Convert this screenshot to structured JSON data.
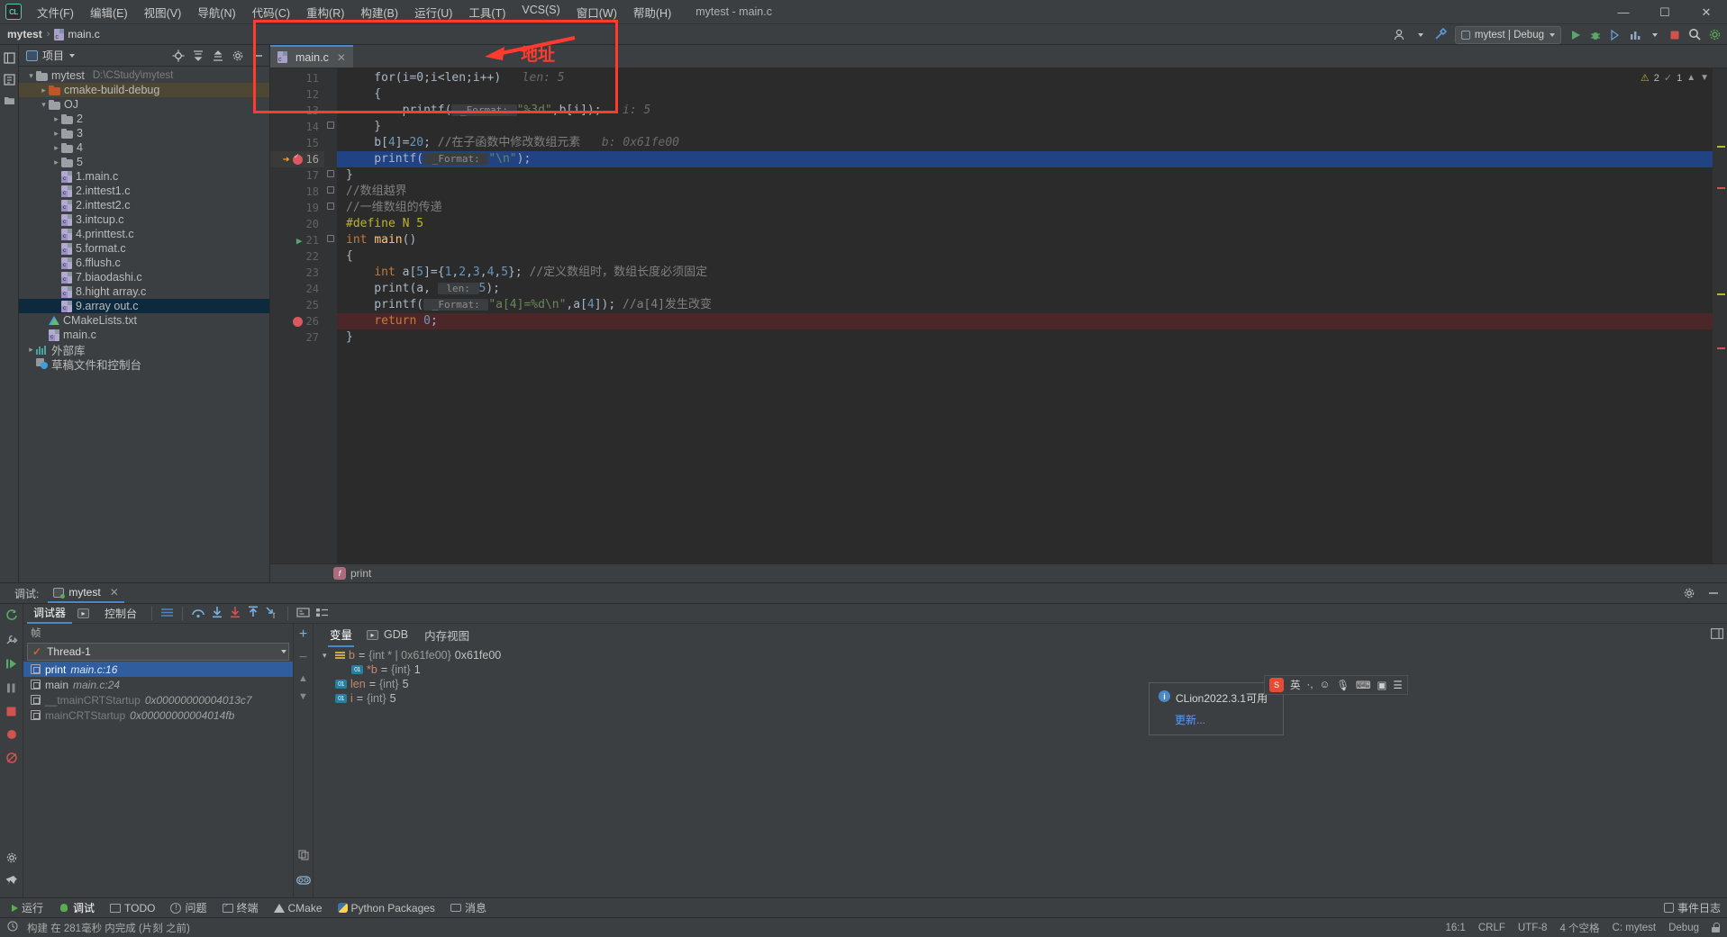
{
  "titlebar": {
    "logo": "CL",
    "window_title": "mytest - main.c",
    "menus": [
      {
        "label": "文件(F)"
      },
      {
        "label": "编辑(E)"
      },
      {
        "label": "视图(V)"
      },
      {
        "label": "导航(N)"
      },
      {
        "label": "代码(C)"
      },
      {
        "label": "重构(R)"
      },
      {
        "label": "构建(B)"
      },
      {
        "label": "运行(U)"
      },
      {
        "label": "工具(T)"
      },
      {
        "label": "VCS(S)"
      },
      {
        "label": "窗口(W)"
      },
      {
        "label": "帮助(H)"
      }
    ],
    "minimize": "—",
    "maximize": "☐",
    "close": "✕"
  },
  "navbar": {
    "crumb_project": "mytest",
    "crumb_sep": "›",
    "crumb_file": "main.c",
    "run_config": "mytest | Debug"
  },
  "project_panel": {
    "title": "项目",
    "left_tabs": [
      "项目",
      "结构"
    ],
    "tree": [
      {
        "indent": 0,
        "arrow": "open",
        "icon": "folder",
        "name": "mytest",
        "path": "D:\\CStudy\\mytest",
        "state": "normal"
      },
      {
        "indent": 1,
        "arrow": "closed",
        "icon": "folder-orange",
        "name": "cmake-build-debug",
        "path": "",
        "state": "highlight"
      },
      {
        "indent": 1,
        "arrow": "open",
        "icon": "folder",
        "name": "OJ",
        "path": "",
        "state": "normal"
      },
      {
        "indent": 2,
        "arrow": "closed",
        "icon": "folder",
        "name": "2",
        "path": "",
        "state": "normal"
      },
      {
        "indent": 2,
        "arrow": "closed",
        "icon": "folder",
        "name": "3",
        "path": "",
        "state": "normal"
      },
      {
        "indent": 2,
        "arrow": "closed",
        "icon": "folder",
        "name": "4",
        "path": "",
        "state": "normal"
      },
      {
        "indent": 2,
        "arrow": "closed",
        "icon": "folder",
        "name": "5",
        "path": "",
        "state": "normal"
      },
      {
        "indent": 2,
        "arrow": "none",
        "icon": "c-file",
        "name": "1.main.c",
        "path": "",
        "state": "normal"
      },
      {
        "indent": 2,
        "arrow": "none",
        "icon": "c-file",
        "name": "2.inttest1.c",
        "path": "",
        "state": "normal"
      },
      {
        "indent": 2,
        "arrow": "none",
        "icon": "c-file",
        "name": "2.inttest2.c",
        "path": "",
        "state": "normal"
      },
      {
        "indent": 2,
        "arrow": "none",
        "icon": "c-file",
        "name": "3.intcup.c",
        "path": "",
        "state": "normal"
      },
      {
        "indent": 2,
        "arrow": "none",
        "icon": "c-file",
        "name": "4.printtest.c",
        "path": "",
        "state": "normal"
      },
      {
        "indent": 2,
        "arrow": "none",
        "icon": "c-file",
        "name": "5.format.c",
        "path": "",
        "state": "normal"
      },
      {
        "indent": 2,
        "arrow": "none",
        "icon": "c-file",
        "name": "6.fflush.c",
        "path": "",
        "state": "normal"
      },
      {
        "indent": 2,
        "arrow": "none",
        "icon": "c-file",
        "name": "7.biaodashi.c",
        "path": "",
        "state": "normal"
      },
      {
        "indent": 2,
        "arrow": "none",
        "icon": "c-file",
        "name": "8.hight array.c",
        "path": "",
        "state": "normal"
      },
      {
        "indent": 2,
        "arrow": "none",
        "icon": "c-file",
        "name": "9.array out.c",
        "path": "",
        "state": "selected"
      },
      {
        "indent": 1,
        "arrow": "none",
        "icon": "cmake",
        "name": "CMakeLists.txt",
        "path": "",
        "state": "normal"
      },
      {
        "indent": 1,
        "arrow": "none",
        "icon": "c-file",
        "name": "main.c",
        "path": "",
        "state": "normal"
      },
      {
        "indent": 0,
        "arrow": "closed",
        "icon": "library",
        "name": "外部库",
        "path": "",
        "state": "normal"
      },
      {
        "indent": 0,
        "arrow": "none",
        "icon": "scratch",
        "name": "草稿文件和控制台",
        "path": "",
        "state": "normal"
      }
    ]
  },
  "editor": {
    "tab_label": "main.c",
    "tab_close": "✕",
    "inspections": {
      "warnings": "2",
      "checks": "1"
    },
    "breadcrumb_fn": "print",
    "breadcrumb_badge": "f",
    "lines": [
      {
        "num": "11",
        "state": "partial",
        "marker": "",
        "segments": [
          {
            "t": "    for(i=0;i<len;i++)",
            "c": "plain"
          },
          {
            "t": "   len: 5",
            "c": "inline-hint"
          }
        ]
      },
      {
        "num": "12",
        "state": "normal",
        "marker": "",
        "segments": [
          {
            "t": "    {",
            "c": "plain"
          }
        ]
      },
      {
        "num": "13",
        "state": "normal",
        "marker": "",
        "segments": [
          {
            "t": "        printf(",
            "c": "plain"
          },
          {
            "t": " _Format: ",
            "c": "param-hint"
          },
          {
            "t": "\"%3d\"",
            "c": "string"
          },
          {
            "t": ",b[i]);",
            "c": "plain"
          },
          {
            "t": "   i: 5",
            "c": "inline-hint"
          }
        ]
      },
      {
        "num": "14",
        "state": "normal",
        "marker": "",
        "segments": [
          {
            "t": "    }",
            "c": "plain"
          }
        ]
      },
      {
        "num": "15",
        "state": "normal",
        "marker": "",
        "segments": [
          {
            "t": "    b[",
            "c": "plain"
          },
          {
            "t": "4",
            "c": "number"
          },
          {
            "t": "]=",
            "c": "plain"
          },
          {
            "t": "20",
            "c": "number"
          },
          {
            "t": "; ",
            "c": "plain"
          },
          {
            "t": "//在子函数中修改数组元素",
            "c": "comment"
          },
          {
            "t": "   b: 0x61fe00",
            "c": "inline-hint"
          }
        ]
      },
      {
        "num": "16",
        "state": "current",
        "marker": "breakpoint-hit",
        "segments": [
          {
            "t": "    printf(",
            "c": "plain"
          },
          {
            "t": " _Format: ",
            "c": "param-hint"
          },
          {
            "t": "\"\\n\"",
            "c": "string"
          },
          {
            "t": ");",
            "c": "plain"
          }
        ]
      },
      {
        "num": "17",
        "state": "normal",
        "marker": "",
        "segments": [
          {
            "t": "}",
            "c": "plain"
          }
        ]
      },
      {
        "num": "18",
        "state": "normal",
        "marker": "",
        "segments": [
          {
            "t": "//数组越界",
            "c": "comment"
          }
        ]
      },
      {
        "num": "19",
        "state": "normal",
        "marker": "",
        "segments": [
          {
            "t": "//一维数组的传递",
            "c": "comment"
          }
        ]
      },
      {
        "num": "20",
        "state": "normal",
        "marker": "",
        "segments": [
          {
            "t": "#define N 5",
            "c": "preproc"
          }
        ]
      },
      {
        "num": "21",
        "state": "normal",
        "marker": "run",
        "segments": [
          {
            "t": "int",
            "c": "keyword"
          },
          {
            "t": " ",
            "c": "plain"
          },
          {
            "t": "main",
            "c": "function"
          },
          {
            "t": "()",
            "c": "plain"
          }
        ]
      },
      {
        "num": "22",
        "state": "normal",
        "marker": "",
        "segments": [
          {
            "t": "{",
            "c": "plain"
          }
        ]
      },
      {
        "num": "23",
        "state": "normal",
        "marker": "",
        "segments": [
          {
            "t": "    ",
            "c": "plain"
          },
          {
            "t": "int",
            "c": "keyword"
          },
          {
            "t": " a[",
            "c": "plain"
          },
          {
            "t": "5",
            "c": "number"
          },
          {
            "t": "]={",
            "c": "plain"
          },
          {
            "t": "1",
            "c": "number"
          },
          {
            "t": ",",
            "c": "plain"
          },
          {
            "t": "2",
            "c": "number"
          },
          {
            "t": ",",
            "c": "plain"
          },
          {
            "t": "3",
            "c": "number"
          },
          {
            "t": ",",
            "c": "plain"
          },
          {
            "t": "4",
            "c": "number"
          },
          {
            "t": ",",
            "c": "plain"
          },
          {
            "t": "5",
            "c": "number"
          },
          {
            "t": "}; ",
            "c": "plain"
          },
          {
            "t": "//定义数组时，数组长度必须固定",
            "c": "comment"
          }
        ]
      },
      {
        "num": "24",
        "state": "normal",
        "marker": "",
        "segments": [
          {
            "t": "    print(a, ",
            "c": "plain"
          },
          {
            "t": " len: ",
            "c": "param-hint"
          },
          {
            "t": "5",
            "c": "number"
          },
          {
            "t": ");",
            "c": "plain"
          }
        ]
      },
      {
        "num": "25",
        "state": "normal",
        "marker": "",
        "segments": [
          {
            "t": "    printf(",
            "c": "plain"
          },
          {
            "t": " _Format: ",
            "c": "param-hint"
          },
          {
            "t": "\"a[4]=%d\\n\"",
            "c": "string"
          },
          {
            "t": ",a[",
            "c": "plain"
          },
          {
            "t": "4",
            "c": "number"
          },
          {
            "t": "]); ",
            "c": "plain"
          },
          {
            "t": "//a[4]发生改变",
            "c": "comment"
          }
        ]
      },
      {
        "num": "26",
        "state": "error",
        "marker": "breakpoint",
        "segments": [
          {
            "t": "    ",
            "c": "plain"
          },
          {
            "t": "return",
            "c": "keyword"
          },
          {
            "t": " ",
            "c": "plain"
          },
          {
            "t": "0",
            "c": "number"
          },
          {
            "t": ";",
            "c": "plain"
          }
        ]
      },
      {
        "num": "27",
        "state": "normal",
        "marker": "",
        "segments": [
          {
            "t": "}",
            "c": "plain"
          }
        ]
      }
    ]
  },
  "debug": {
    "header_label": "调试:",
    "session_tab": "mytest",
    "session_close": "✕",
    "toolbar_tabs": [
      {
        "label": "调试器",
        "active": true
      },
      {
        "label": "控制台",
        "active": false
      }
    ],
    "frames": {
      "header": "帧",
      "thread": "Thread-1",
      "rows": [
        {
          "name": "print",
          "loc": "main.c:16",
          "selected": true,
          "dim": false
        },
        {
          "name": "main",
          "loc": "main.c:24",
          "selected": false,
          "dim": false
        },
        {
          "name": "__tmainCRTStartup",
          "loc": "0x00000000004013c7",
          "selected": false,
          "dim": true
        },
        {
          "name": "mainCRTStartup",
          "loc": "0x00000000004014fb",
          "selected": false,
          "dim": true
        }
      ]
    },
    "variables": {
      "tabs": [
        {
          "label": "变量",
          "active": true,
          "icon": ""
        },
        {
          "label": "GDB",
          "active": false,
          "icon": "gdb-badge"
        },
        {
          "label": "内存视图",
          "active": false,
          "icon": ""
        }
      ],
      "rows": [
        {
          "indent": 0,
          "chevron": "open",
          "icon": "pointer",
          "name": "b",
          "type": "{int * | 0x61fe00}",
          "value": "0x61fe00"
        },
        {
          "indent": 1,
          "chevron": "",
          "icon": "int",
          "name": "*b",
          "type": "{int}",
          "value": "1"
        },
        {
          "indent": 0,
          "chevron": "",
          "icon": "int",
          "name": "len",
          "type": "{int}",
          "value": "5"
        },
        {
          "indent": 0,
          "chevron": "",
          "icon": "int",
          "name": "i",
          "type": "{int}",
          "value": "5"
        }
      ]
    }
  },
  "annotation": {
    "label": "地址",
    "color": "#ff3b30"
  },
  "notification": {
    "title": "CLion2022.3.1可用",
    "link": "更新..."
  },
  "ime": {
    "lang": "英",
    "items": [
      "英",
      "·,",
      "☺",
      "🎙",
      "⌨",
      "✂",
      "▤",
      "☰"
    ]
  },
  "bottom_bar": {
    "items": [
      {
        "label": "运行",
        "icon": "run-icon",
        "active": false
      },
      {
        "label": "调试",
        "icon": "debug-icon",
        "active": true
      },
      {
        "label": "TODO",
        "icon": "todo-icon",
        "active": false
      },
      {
        "label": "问题",
        "icon": "problems-icon",
        "active": false
      },
      {
        "label": "终端",
        "icon": "terminal-icon",
        "active": false
      },
      {
        "label": "CMake",
        "icon": "cmake-icon",
        "active": false
      },
      {
        "label": "Python Packages",
        "icon": "python-icon",
        "active": false
      },
      {
        "label": "消息",
        "icon": "messages-icon",
        "active": false
      }
    ],
    "event_log": "事件日志"
  },
  "statusbar": {
    "build_message": "构建 在 281毫秒 内完成 (片刻 之前)",
    "caret": "16:1",
    "line_sep": "CRLF",
    "encoding": "UTF-8",
    "indent": "4 个空格",
    "branch": "C: mytest",
    "config": "Debug"
  }
}
